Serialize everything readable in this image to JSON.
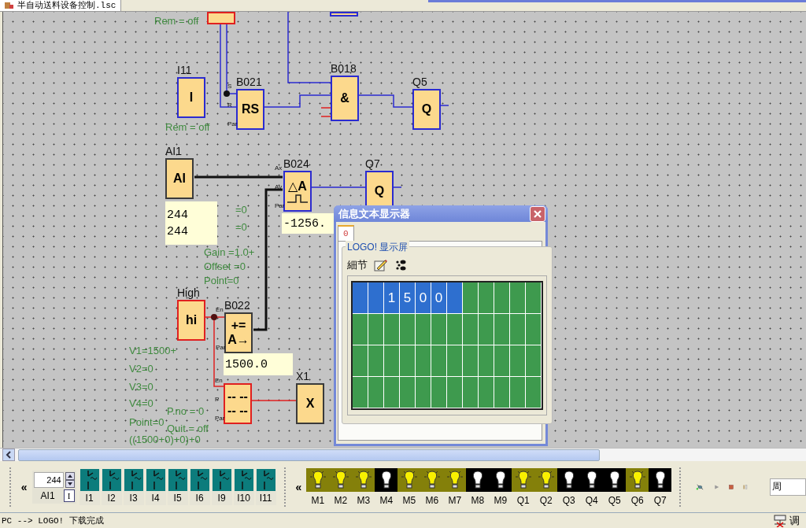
{
  "file_tab": {
    "title": "半自动送料设备控制.lsc"
  },
  "diagram": {
    "blocks": [
      {
        "kind": "plain",
        "color": "#e02020"
      },
      {
        "kind": "plain",
        "color": "#2b2bd0"
      },
      {
        "kind": "plain",
        "label": "I11",
        "symbol_lines": [
          "I"
        ],
        "color": "#2b2bd0"
      },
      {
        "kind": "plain",
        "label": "B021",
        "symbol_lines": [
          "RS"
        ],
        "color": "#2b2bd0",
        "pins": [
          "S",
          "R",
          "Par"
        ]
      },
      {
        "kind": "plain",
        "label": "B018",
        "symbol_lines": [
          "&"
        ],
        "color": "#2b2bd0"
      },
      {
        "kind": "plain",
        "label": "Q5",
        "symbol_lines": [
          "Q"
        ],
        "color": "#2b2bd0"
      },
      {
        "kind": "plain",
        "label": "AI1",
        "symbol_lines": [
          "AI"
        ],
        "color": "#3a3a3a"
      },
      {
        "kind": "pulse",
        "label": "B024",
        "symbol_lines": [
          "△A"
        ],
        "color": "#2b2bd0",
        "pins": [
          "Ax",
          "Av",
          "Par"
        ]
      },
      {
        "kind": "plain",
        "label": "Q7",
        "symbol_lines": [
          "Q"
        ],
        "color": "#2b2bd0"
      },
      {
        "kind": "plain",
        "label": "High",
        "symbol_lines": [
          "hi"
        ],
        "color": "#e02020"
      },
      {
        "kind": "plain",
        "label": "B022",
        "symbol_lines": [
          "+=",
          "A→"
        ],
        "color": "#3a3a3a",
        "pins": [
          "En",
          "Par"
        ]
      },
      {
        "kind": "plain",
        "symbol_lines": [
          "-- --",
          "-- --"
        ],
        "color": "#e02020",
        "pins": [
          "En",
          "P",
          "Par"
        ]
      },
      {
        "kind": "plain",
        "label": "X1",
        "symbol_lines": [
          "X"
        ],
        "color": "#3a3a3a"
      }
    ],
    "parameters": [
      {
        "text": "Rem = off"
      },
      {
        "text": "Rem = off"
      },
      {
        "text": "=0"
      },
      {
        "text": "=0"
      },
      {
        "text": "Gain =1.0+"
      },
      {
        "text": "Offset =0"
      },
      {
        "text": "Point=0"
      },
      {
        "text": "V1=1500+"
      },
      {
        "text": "V2=0"
      },
      {
        "text": "V3=0"
      },
      {
        "text": "V4=0"
      },
      {
        "text": "P.no = 0"
      },
      {
        "text": "Point=0"
      },
      {
        "text": "Quit = off"
      },
      {
        "text": "((1500+0)+0)+0"
      }
    ],
    "value_boxes": [
      {
        "lines": [
          "244",
          "244"
        ]
      },
      {
        "lines": [
          "-1256."
        ]
      },
      {
        "lines": [
          "1500.0"
        ]
      }
    ]
  },
  "info_text_dialog": {
    "title": "信息文本显示器",
    "tabs": [
      {
        "label": "0",
        "selected": true
      }
    ],
    "group_label": "LOGO! 显示屏",
    "details_label": "細节",
    "display": {
      "rows": [
        {
          "cells": [
            {
              "highlighted": true
            },
            {
              "highlighted": true
            },
            {
              "highlighted": true,
              "text": "1"
            },
            {
              "highlighted": true,
              "text": "5"
            },
            {
              "highlighted": true,
              "text": "0"
            },
            {
              "highlighted": true,
              "text": "0"
            },
            {
              "highlighted": true
            },
            {
              "highlighted": false
            },
            {
              "highlighted": false
            },
            {
              "highlighted": false
            },
            {
              "highlighted": false
            },
            {
              "highlighted": false
            }
          ]
        },
        {
          "cells": [
            {
              "highlighted": false
            },
            {
              "highlighted": false
            },
            {
              "highlighted": false
            },
            {
              "highlighted": false
            },
            {
              "highlighted": false
            },
            {
              "highlighted": false
            },
            {
              "highlighted": false
            },
            {
              "highlighted": false
            },
            {
              "highlighted": false
            },
            {
              "highlighted": false
            },
            {
              "highlighted": false
            },
            {
              "highlighted": false
            }
          ]
        },
        {
          "cells": [
            {
              "highlighted": false
            },
            {
              "highlighted": false
            },
            {
              "highlighted": false
            },
            {
              "highlighted": false
            },
            {
              "highlighted": false
            },
            {
              "highlighted": false
            },
            {
              "highlighted": false
            },
            {
              "highlighted": false
            },
            {
              "highlighted": false
            },
            {
              "highlighted": false
            },
            {
              "highlighted": false
            },
            {
              "highlighted": false
            }
          ]
        },
        {
          "cells": [
            {
              "highlighted": false
            },
            {
              "highlighted": false
            },
            {
              "highlighted": false
            },
            {
              "highlighted": false
            },
            {
              "highlighted": false
            },
            {
              "highlighted": false
            },
            {
              "highlighted": false
            },
            {
              "highlighted": false
            },
            {
              "highlighted": false
            },
            {
              "highlighted": false
            },
            {
              "highlighted": false
            },
            {
              "highlighted": false
            }
          ]
        }
      ]
    }
  },
  "simulation_bar": {
    "inputs_collapse": "«",
    "analog_input": {
      "value": "244",
      "label": "AI1",
      "mode_button": "I"
    },
    "inputs": [
      {
        "label": "I1",
        "on": false
      },
      {
        "label": "I2",
        "on": false
      },
      {
        "label": "I3",
        "on": false
      },
      {
        "label": "I4",
        "on": false
      },
      {
        "label": "I5",
        "on": false
      },
      {
        "label": "I6",
        "on": false
      },
      {
        "label": "I9",
        "on": false
      },
      {
        "label": "I10",
        "on": false
      },
      {
        "label": "I11",
        "on": false
      }
    ],
    "outputs_collapse": "«",
    "outputs": [
      {
        "label": "M1",
        "on": true
      },
      {
        "label": "M2",
        "on": true
      },
      {
        "label": "M3",
        "on": true
      },
      {
        "label": "M4",
        "on": false
      },
      {
        "label": "M5",
        "on": true
      },
      {
        "label": "M6",
        "on": true
      },
      {
        "label": "M7",
        "on": true
      },
      {
        "label": "M8",
        "on": false
      },
      {
        "label": "M9",
        "on": false
      },
      {
        "label": "Q1",
        "on": true
      },
      {
        "label": "Q2",
        "on": true
      },
      {
        "label": "Q3",
        "on": false
      },
      {
        "label": "Q4",
        "on": false
      },
      {
        "label": "Q5",
        "on": false
      },
      {
        "label": "Q6",
        "on": true
      },
      {
        "label": "Q7",
        "on": false
      }
    ],
    "field": {
      "value": "周"
    }
  },
  "status_bar": {
    "message": "PC --> LOGO! 下载完成",
    "right_label": "调"
  }
}
